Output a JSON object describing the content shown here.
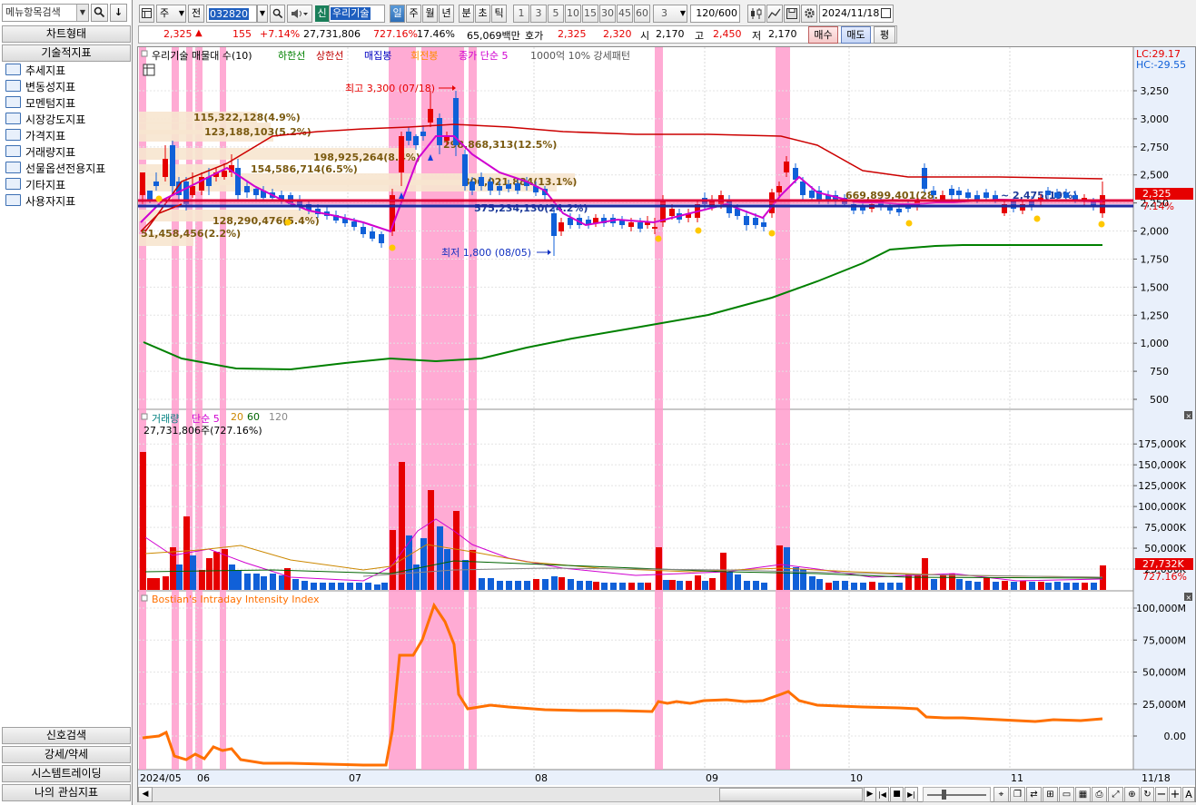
{
  "search": {
    "label": "메뉴항목검색"
  },
  "left_panel": {
    "chart_type_tab": "차트형태",
    "tech_indicator_tab": "기술적지표",
    "folders": [
      "추세지표",
      "변동성지표",
      "모멘텀지표",
      "시장강도지표",
      "가격지표",
      "거래량지표",
      "선물옵션전용지표",
      "기타지표",
      "사용자지표"
    ],
    "bottom_tabs": [
      "신호검색",
      "강세/약세",
      "시스템트레이딩",
      "나의 관심지표"
    ]
  },
  "toolbar": {
    "mode": "주",
    "prev": "전",
    "code": "032820",
    "credit_badge": "신",
    "stock_name": "우리기술",
    "periods": [
      "일",
      "주",
      "월",
      "년",
      "분",
      "초",
      "틱"
    ],
    "active_period": "일",
    "intervals": [
      "1",
      "3",
      "5",
      "10",
      "15",
      "30",
      "45",
      "60"
    ],
    "interval_select": "3",
    "count": "120",
    "count_max": "/600",
    "date": "2024/11/18"
  },
  "quote": {
    "price": "2,325",
    "arrow": "▲",
    "change": "155",
    "change_pct": "+7.14%",
    "volume": "27,731,806",
    "volume_ratio": "727.16%",
    "turnover": "17.46%",
    "amount": "65,069백만",
    "bid_label": "호가",
    "ask": "2,325",
    "bid": "2,320",
    "open_label": "시",
    "open": "2,170",
    "high_label": "고",
    "high": "2,450",
    "low_label": "저",
    "low": "2,170",
    "buy": "매수",
    "sell": "매도",
    "eval": "평"
  },
  "price_panel": {
    "legend": [
      "우리기술 매물대 수(10)",
      "하한선",
      "상한선",
      "매집봉",
      "회전봉",
      "종가 단순 5",
      "1000억 10% 강세패턴"
    ],
    "legend_colors": [
      "#000000",
      "#008000",
      "#c00000",
      "#0000c0",
      "#ff8c00",
      "#d000d0",
      "#555555"
    ],
    "lc": "LC:29.17",
    "hc": "HC:-29.55",
    "y_ticks": [
      "3,250",
      "3,000",
      "2,750",
      "2,500",
      "2,250",
      "2,000",
      "1,750",
      "1,500",
      "1,250",
      "1,000",
      "750",
      "500"
    ],
    "current_price_tag": "2,325",
    "current_pct_tag": "7.14%",
    "high_marker": "최고 3,300 (07/18)",
    "low_marker": "최저 1,800 (08/05)",
    "volume_profile_labels": [
      "115,322,128(4.9%)",
      "123,188,103(5.2%)",
      "198,925,264(8.4%)",
      "154,586,714(6.5%)",
      "298,868,313(12.5%)",
      "306,021,884(13.1%)",
      "669,899,401(28.",
      "128,290,476(5.4%)",
      "51,458,456(2.2%)",
      "575,234,130(24.2%)",
      "~ 2,475(19%)"
    ]
  },
  "volume_panel": {
    "legend": [
      "거래량",
      "단순 5",
      "20",
      "60",
      "120"
    ],
    "legend_colors": [
      "#008080",
      "#d000d0",
      "#cc8800",
      "#006400",
      "#888888"
    ],
    "subtitle": "27,731,806주(727.16%)",
    "y_ticks": [
      "175,000K",
      "150,000K",
      "125,000K",
      "100,000K",
      "75,000K",
      "50,000K",
      "25,000K"
    ],
    "volume_tag": "27,732K",
    "volume_pct_tag": "727.16%"
  },
  "iii_panel": {
    "legend": "Bostian's Intraday Intensity Index",
    "y_ticks": [
      "100,000M",
      "75,000M",
      "50,000M",
      "25,000M",
      "0.00"
    ]
  },
  "x_axis": {
    "labels": [
      "2024/05",
      "06",
      "07",
      "08",
      "09",
      "10",
      "11",
      "11/18"
    ]
  },
  "colors": {
    "up": "#e60000",
    "down": "#1060d8",
    "highlight": "#ff9ccc",
    "ma5": "#d000d0",
    "upper_band": "#cc0000",
    "lower_band": "#008000",
    "iii_line": "#ff7000"
  }
}
